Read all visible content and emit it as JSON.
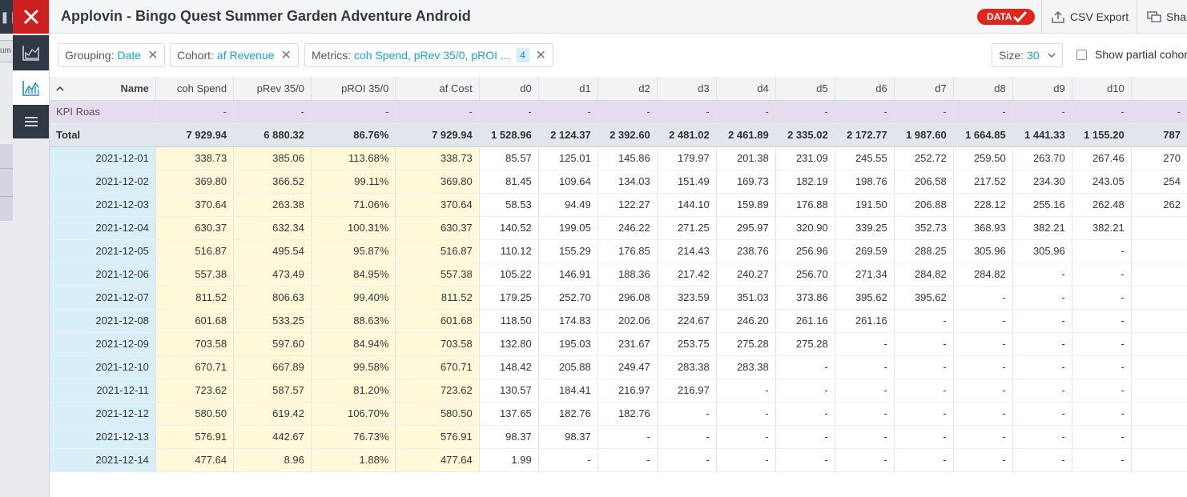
{
  "app": {
    "title": "Applovin - Bingo Quest Summer Garden Adventure Android",
    "data_badge": "DATA",
    "csv_export": "CSV Export",
    "share": "Shar",
    "colors": {
      "close": "#cc1f1f",
      "dark": "#2f3843",
      "accent": "#1aa0d8",
      "badge": "#e0261a"
    }
  },
  "left": {
    "bg_label": "um"
  },
  "filters": {
    "grouping": {
      "label": "Grouping:",
      "value": "Date"
    },
    "cohort": {
      "label": "Cohort:",
      "value": "af Revenue"
    },
    "metrics": {
      "label": "Metrics:",
      "value": "coh Spend, pRev 35/0, pROI ...",
      "count": "4"
    },
    "size": {
      "label": "Size:",
      "value": "30"
    },
    "partial": "Show partial cohort"
  },
  "table": {
    "headers": [
      "Name",
      "coh Spend",
      "pRev 35/0",
      "pROI 35/0",
      "af Cost",
      "d0",
      "d1",
      "d2",
      "d3",
      "d4",
      "d5",
      "d6",
      "d7",
      "d8",
      "d9",
      "d10",
      ""
    ],
    "kpi_row": [
      "KPI Roas",
      "-",
      "-",
      "-",
      "-",
      "-",
      "-",
      "-",
      "-",
      "-",
      "-",
      "-",
      "-",
      "-",
      "-",
      "-",
      "-"
    ],
    "total_row": [
      "Total",
      "7 929.94",
      "6 880.32",
      "86.76%",
      "7 929.94",
      "1 528.96",
      "2 124.37",
      "2 392.60",
      "2 481.02",
      "2 461.89",
      "2 335.02",
      "2 172.77",
      "1 987.60",
      "1 664.85",
      "1 441.33",
      "1 155.20",
      "787"
    ],
    "rows": [
      [
        "2021-12-01",
        "338.73",
        "385.06",
        "113.68%",
        "338.73",
        "85.57",
        "125.01",
        "145.86",
        "179.97",
        "201.38",
        "231.09",
        "245.55",
        "252.72",
        "259.50",
        "263.70",
        "267.46",
        "270"
      ],
      [
        "2021-12-02",
        "369.80",
        "366.52",
        "99.11%",
        "369.80",
        "81.45",
        "109.64",
        "134.03",
        "151.49",
        "169.73",
        "182.19",
        "198.76",
        "206.58",
        "217.52",
        "234.30",
        "243.05",
        "254"
      ],
      [
        "2021-12-03",
        "370.64",
        "263.38",
        "71.06%",
        "370.64",
        "58.53",
        "94.49",
        "122.27",
        "144.10",
        "159.89",
        "176.88",
        "191.50",
        "206.88",
        "228.12",
        "255.16",
        "262.48",
        "262"
      ],
      [
        "2021-12-04",
        "630.37",
        "632.34",
        "100.31%",
        "630.37",
        "140.52",
        "199.05",
        "246.22",
        "271.25",
        "295.97",
        "320.90",
        "339.25",
        "352.73",
        "368.93",
        "382.21",
        "382.21",
        ""
      ],
      [
        "2021-12-05",
        "516.87",
        "495.54",
        "95.87%",
        "516.87",
        "110.12",
        "155.29",
        "176.85",
        "214.43",
        "238.76",
        "256.96",
        "269.59",
        "288.25",
        "305.96",
        "305.96",
        "-",
        ""
      ],
      [
        "2021-12-06",
        "557.38",
        "473.49",
        "84.95%",
        "557.38",
        "105.22",
        "146.91",
        "188.36",
        "217.42",
        "240.27",
        "256.70",
        "271.34",
        "284.82",
        "284.82",
        "-",
        "-",
        ""
      ],
      [
        "2021-12-07",
        "811.52",
        "806.63",
        "99.40%",
        "811.52",
        "179.25",
        "252.70",
        "296.08",
        "323.59",
        "351.03",
        "373.86",
        "395.62",
        "395.62",
        "-",
        "-",
        "-",
        ""
      ],
      [
        "2021-12-08",
        "601.68",
        "533.25",
        "88.63%",
        "601.68",
        "118.50",
        "174.83",
        "202.06",
        "224.67",
        "246.20",
        "261.16",
        "261.16",
        "-",
        "-",
        "-",
        "-",
        ""
      ],
      [
        "2021-12-09",
        "703.58",
        "597.60",
        "84.94%",
        "703.58",
        "132.80",
        "195.03",
        "231.67",
        "253.75",
        "275.28",
        "275.28",
        "-",
        "-",
        "-",
        "-",
        "-",
        ""
      ],
      [
        "2021-12-10",
        "670.71",
        "667.89",
        "99.58%",
        "670.71",
        "148.42",
        "205.88",
        "249.47",
        "283.38",
        "283.38",
        "-",
        "-",
        "-",
        "-",
        "-",
        "-",
        ""
      ],
      [
        "2021-12-11",
        "723.62",
        "587.57",
        "81.20%",
        "723.62",
        "130.57",
        "184.41",
        "216.97",
        "216.97",
        "-",
        "-",
        "-",
        "-",
        "-",
        "-",
        "-",
        ""
      ],
      [
        "2021-12-12",
        "580.50",
        "619.42",
        "106.70%",
        "580.50",
        "137.65",
        "182.76",
        "182.76",
        "-",
        "-",
        "-",
        "-",
        "-",
        "-",
        "-",
        "-",
        ""
      ],
      [
        "2021-12-13",
        "576.91",
        "442.67",
        "76.73%",
        "576.91",
        "98.37",
        "98.37",
        "-",
        "-",
        "-",
        "-",
        "-",
        "-",
        "-",
        "-",
        "-",
        ""
      ],
      [
        "2021-12-14",
        "477.64",
        "8.96",
        "1.88%",
        "477.64",
        "1.99",
        "-",
        "-",
        "-",
        "-",
        "-",
        "-",
        "-",
        "-",
        "-",
        "-",
        ""
      ]
    ]
  }
}
